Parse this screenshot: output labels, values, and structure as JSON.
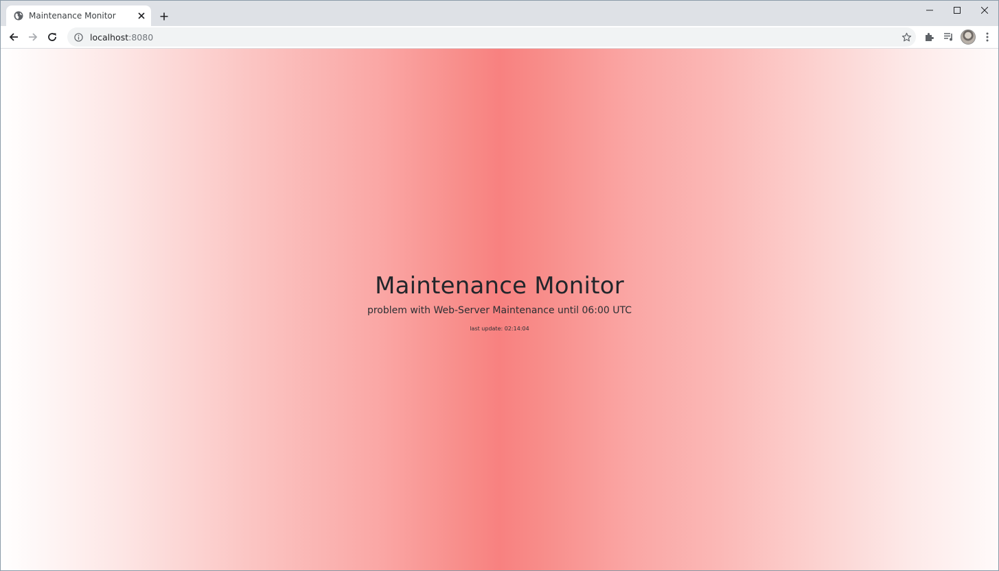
{
  "browser": {
    "tab": {
      "title": "Maintenance Monitor",
      "favicon": "globe-icon"
    },
    "address": {
      "host": "localhost",
      "port": ":8080"
    }
  },
  "page": {
    "title": "Maintenance Monitor",
    "status": "problem with Web-Server Maintenance until 06:00 UTC",
    "last_update": "last update: 02:14:04",
    "background_accent": "#f88180"
  }
}
